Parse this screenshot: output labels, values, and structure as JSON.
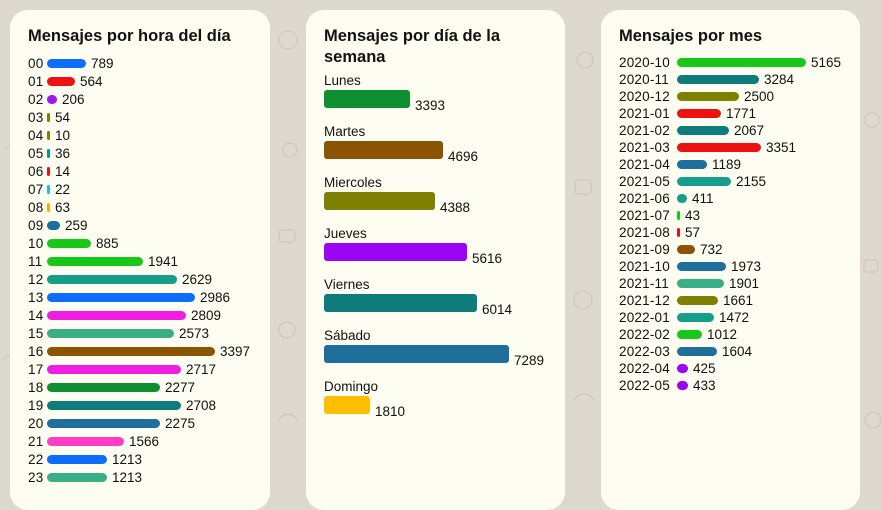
{
  "chart_data": [
    {
      "type": "bar",
      "title": "Mensajes por hora del día",
      "categories": [
        "00",
        "01",
        "02",
        "03",
        "04",
        "05",
        "06",
        "07",
        "08",
        "09",
        "10",
        "11",
        "12",
        "13",
        "14",
        "15",
        "16",
        "17",
        "18",
        "19",
        "20",
        "21",
        "22",
        "23"
      ],
      "values": [
        789,
        564,
        206,
        54,
        10,
        36,
        14,
        22,
        63,
        259,
        885,
        1941,
        2629,
        2986,
        2809,
        2573,
        3397,
        2717,
        2277,
        2708,
        2275,
        1566,
        1213,
        1213
      ],
      "colors": [
        "#0d6efd",
        "#ee1111",
        "#9b17f0",
        "#7d8000",
        "#7d8000",
        "#0f8f8f",
        "#ee1111",
        "#1fc0d8",
        "#f0b400",
        "#1f6f9c",
        "#18c818",
        "#18c818",
        "#159e8a",
        "#0d6efd",
        "#f21de2",
        "#3aae84",
        "#8b5400",
        "#f21de2",
        "#0f8f2f",
        "#0f7c7c",
        "#1f6f9c",
        "#ff3cc2",
        "#0d6efd",
        "#3aae84"
      ]
    },
    {
      "type": "bar",
      "title": "Mensajes por día de la semana",
      "categories": [
        "Lunes",
        "Martes",
        "Miercoles",
        "Jueves",
        "Viernes",
        "Sábado",
        "Domingo"
      ],
      "values": [
        3393,
        4696,
        4388,
        5616,
        6014,
        7289,
        1810
      ],
      "colors": [
        "#0f8f2f",
        "#8b5400",
        "#7d8000",
        "#9b05f5",
        "#0f7c7c",
        "#1f6f9c",
        "#ffbf00"
      ]
    },
    {
      "type": "bar",
      "title": "Mensajes por mes",
      "categories": [
        "2020-10",
        "2020-11",
        "2020-12",
        "2021-01",
        "2021-02",
        "2021-03",
        "2021-04",
        "2021-05",
        "2021-06",
        "2021-07",
        "2021-08",
        "2021-09",
        "2021-10",
        "2021-11",
        "2021-12",
        "2022-01",
        "2022-02",
        "2022-03",
        "2022-04",
        "2022-05"
      ],
      "values": [
        5165,
        3284,
        2500,
        1771,
        2067,
        3351,
        1189,
        2155,
        411,
        43,
        57,
        732,
        1973,
        1901,
        1661,
        1472,
        1012,
        1604,
        425,
        433
      ],
      "colors": [
        "#18c818",
        "#0f7c7c",
        "#7d8000",
        "#ee1111",
        "#0f7c7c",
        "#ee1111",
        "#1f6f9c",
        "#159e8a",
        "#159e8a",
        "#18c818",
        "#ee1111",
        "#8b5400",
        "#1f6f9c",
        "#3aae84",
        "#7d8000",
        "#159e8a",
        "#18c818",
        "#1f6f9c",
        "#9b05f5",
        "#9b05f5"
      ]
    }
  ]
}
